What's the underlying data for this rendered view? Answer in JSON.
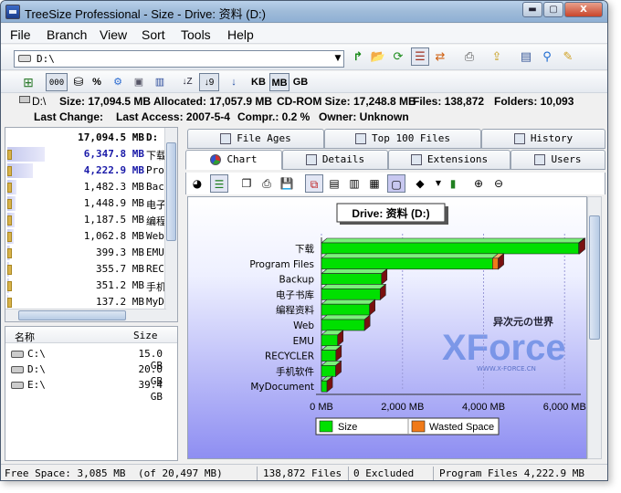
{
  "window": {
    "title": "TreeSize Professional - Size -  Drive: 资料 (D:)",
    "min_label": "▬",
    "max_label": "▢",
    "close_label": "X"
  },
  "menu": [
    "File",
    "Branch",
    "View",
    "Sort",
    "Tools",
    "Help"
  ],
  "toolbar": {
    "path_value": "D:\\",
    "unit_buttons": [
      "KB",
      "MB",
      "GB"
    ],
    "active_unit": "MB",
    "count_button": "000",
    "percent_button": "%"
  },
  "info": {
    "drive": "D:\\",
    "size": "Size: 17,094.5 MB",
    "allocated": "Allocated: 17,057.9 MB",
    "cdrom_size": "CD-ROM Size: 17,248.8 MB",
    "files": "Files: 138,872",
    "folders": "Folders: 10,093",
    "last_change": "Last Change:",
    "last_access": "Last Access: 2007-5-4",
    "compr": "Compr.: 0.2 %",
    "owner": "Owner: Unknown"
  },
  "tree": {
    "root_size": "17,094.5 MB",
    "root_name": "D:",
    "items": [
      {
        "size": "6,347.8 MB",
        "name": "下载",
        "fill": 0.37,
        "highlight": true
      },
      {
        "size": "4,222.9 MB",
        "name": "Program Files",
        "fill": 0.25,
        "highlight": true
      },
      {
        "size": "1,482.3 MB",
        "name": "Backup",
        "fill": 0.09,
        "highlight": false
      },
      {
        "size": "1,448.9 MB",
        "name": "电子书库",
        "fill": 0.085,
        "highlight": false
      },
      {
        "size": "1,187.5 MB",
        "name": "编程资料",
        "fill": 0.07,
        "highlight": false
      },
      {
        "size": "1,062.8 MB",
        "name": "Web",
        "fill": 0.062,
        "highlight": false
      },
      {
        "size": "399.3 MB",
        "name": "EMU",
        "fill": 0.023,
        "highlight": false
      },
      {
        "size": "355.7 MB",
        "name": "RECYCLER",
        "fill": 0.021,
        "highlight": false
      },
      {
        "size": "351.2 MB",
        "name": "手机软件",
        "fill": 0.02,
        "highlight": false
      },
      {
        "size": "137.2 MB",
        "name": "MyDocument",
        "fill": 0.008,
        "highlight": false
      }
    ]
  },
  "drives": {
    "col_name": "名称",
    "col_size": "Size",
    "rows": [
      {
        "name": "C:\\",
        "size": "15.0 GB"
      },
      {
        "name": "D:\\",
        "size": "20.0 GB"
      },
      {
        "name": "E:\\",
        "size": "39.4 GB"
      }
    ]
  },
  "tabs": {
    "row1": [
      "File Ages",
      "Top 100 Files",
      "History"
    ],
    "row2": [
      "Chart",
      "Details",
      "Extensions",
      "Users"
    ],
    "active": "Chart"
  },
  "chart_data": {
    "type": "bar",
    "title": "Drive: 资料 (D:)",
    "categories": [
      "下载",
      "Program Files",
      "Backup",
      "电子书库",
      "编程资料",
      "Web",
      "EMU",
      "RECYCLER",
      "手机软件",
      "MyDocument"
    ],
    "series": [
      {
        "name": "Size",
        "color": "#00e000",
        "values": [
          6347.8,
          4222.9,
          1482.3,
          1448.9,
          1187.5,
          1062.8,
          399.3,
          355.7,
          351.2,
          137.2
        ]
      },
      {
        "name": "Wasted Space",
        "color": "#f07a18",
        "values": [
          20,
          140,
          0,
          0,
          0,
          0,
          0,
          0,
          0,
          0
        ]
      }
    ],
    "xticks": [
      "0 MB",
      "2,000 MB",
      "4,000 MB",
      "6,000 MB"
    ],
    "xlim": [
      0,
      6400
    ],
    "legend": "bottom",
    "grid": true
  },
  "watermark": {
    "text": "XForce",
    "cn": "异次元の世界",
    "url": "WWW.X-FORCE.CN"
  },
  "status": {
    "free_space": "Free Space: 3,085 MB",
    "free_pct": "(of 20,497 MB)",
    "files": "138,872  Files",
    "excluded": "0 Excluded",
    "selected": "Program Files 4,222.9 MB"
  }
}
